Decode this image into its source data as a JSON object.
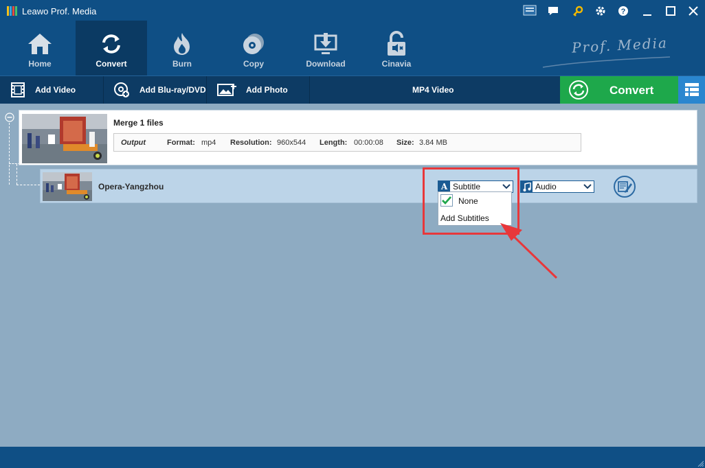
{
  "window": {
    "title": "Leawo Prof. Media",
    "brand_text": "Prof. Media"
  },
  "nav": {
    "items": [
      {
        "label": "Home",
        "icon": "home-icon",
        "active": false
      },
      {
        "label": "Convert",
        "icon": "convert-icon",
        "active": true
      },
      {
        "label": "Burn",
        "icon": "burn-icon",
        "active": false
      },
      {
        "label": "Copy",
        "icon": "copy-icon",
        "active": false
      },
      {
        "label": "Download",
        "icon": "download-icon",
        "active": false
      },
      {
        "label": "Cinavia",
        "icon": "cinavia-icon",
        "active": false
      }
    ]
  },
  "toolbar": {
    "add_video": "Add Video",
    "add_bluray": "Add Blu-ray/DVD",
    "add_photo": "Add Photo",
    "format": "MP4 Video",
    "convert": "Convert"
  },
  "merge": {
    "title": "Merge 1 files",
    "output_label": "Output",
    "format_label": "Format:",
    "format_value": "mp4",
    "resolution_label": "Resolution:",
    "resolution_value": "960x544",
    "length_label": "Length:",
    "length_value": "00:00:08",
    "size_label": "Size:",
    "size_value": "3.84 MB"
  },
  "file": {
    "name": "Opera-Yangzhou",
    "subtitle_select": "Subtitle",
    "audio_select": "Audio"
  },
  "dropdown": {
    "none": "None",
    "none_checked": true,
    "add_subtitles": "Add Subtitles"
  },
  "colors": {
    "header": "#0f4f85",
    "convert_green": "#1ea84b",
    "content_bg": "#8eabc2",
    "highlight_red": "#e8373a"
  }
}
